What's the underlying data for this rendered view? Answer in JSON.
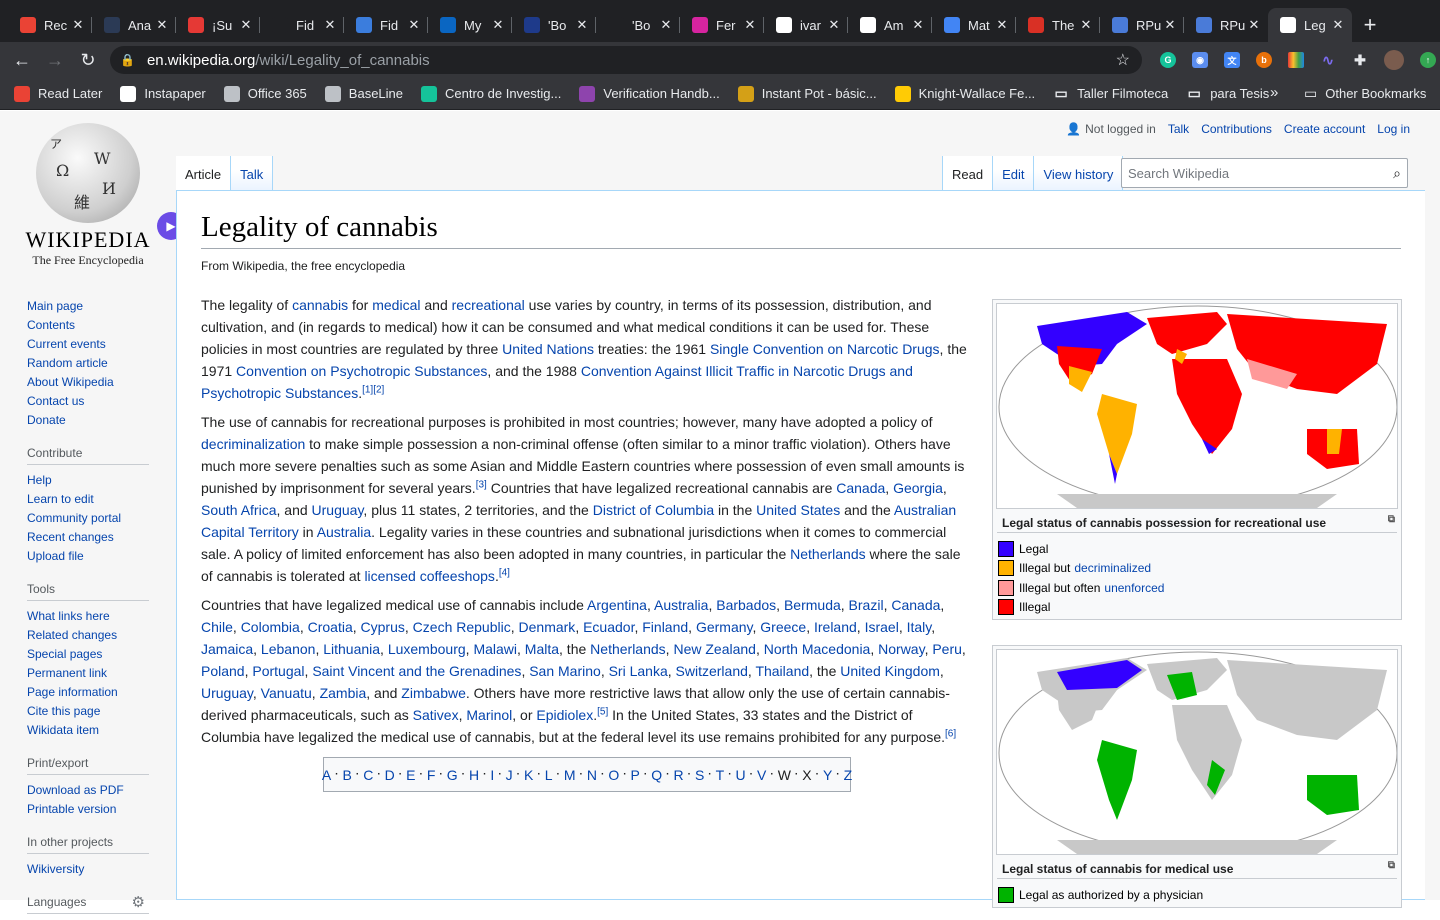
{
  "browser": {
    "tabs": [
      {
        "title": "Rec",
        "icon": "gmail-icon",
        "color": "#ea4335"
      },
      {
        "title": "Ana",
        "icon": "p-icon",
        "color": "#2b3a55"
      },
      {
        "title": "¡Su",
        "icon": "record-icon",
        "color": "#e53935"
      },
      {
        "title": "Fid",
        "icon": "a-icon",
        "color": "#202124"
      },
      {
        "title": "Fid",
        "icon": "blue-doc-icon",
        "color": "#3b7ddd"
      },
      {
        "title": "My",
        "icon": "linkedin-icon",
        "color": "#0a66c2"
      },
      {
        "title": "'Bo",
        "icon": "w-icon",
        "color": "#1e3a8a"
      },
      {
        "title": "'Bo",
        "icon": "guardian-icon",
        "color": "#202124"
      },
      {
        "title": "Fer",
        "icon": "instagram-icon",
        "color": "#d6249f"
      },
      {
        "title": "ivar",
        "icon": "google-icon",
        "color": "#ffffff"
      },
      {
        "title": "Am",
        "icon": "amazon-icon",
        "color": "#ffffff"
      },
      {
        "title": "Mat",
        "icon": "docs-icon",
        "color": "#4285f4"
      },
      {
        "title": "The",
        "icon": "cjr-icon",
        "color": "#d93025"
      },
      {
        "title": "RPu",
        "icon": "r-icon",
        "color": "#4a7bd8"
      },
      {
        "title": "RPu",
        "icon": "r-icon",
        "color": "#4a7bd8"
      },
      {
        "title": "Leg",
        "icon": "wikipedia-icon",
        "color": "#ffffff"
      }
    ],
    "url_domain": "en.wikipedia.org",
    "url_path": "/wiki/Legality_of_cannabis",
    "bookmarks": [
      {
        "label": "Read Later",
        "icon": "gmail-icon",
        "color": "#ea4335"
      },
      {
        "label": "Instapaper",
        "icon": "instapaper-icon",
        "color": "#ffffff"
      },
      {
        "label": "Office 365",
        "icon": "globe-icon",
        "color": "#bdc1c6"
      },
      {
        "label": "BaseLine",
        "icon": "apple-icon",
        "color": "#bdc1c6"
      },
      {
        "label": "Centro de Investig...",
        "icon": "grammarly-icon",
        "color": "#15c39a"
      },
      {
        "label": "Verification Handb...",
        "icon": "feather-icon",
        "color": "#8e44ad"
      },
      {
        "label": "Instant Pot - básic...",
        "icon": "instant-pot-icon",
        "color": "#d4a017"
      },
      {
        "label": "Knight-Wallace Fe...",
        "icon": "michigan-icon",
        "color": "#ffcb05"
      },
      {
        "label": "Taller Filmoteca",
        "icon": "folder-icon",
        "color": "#e8eaed"
      },
      {
        "label": "para Tesis",
        "icon": "folder-icon",
        "color": "#e8eaed"
      }
    ],
    "bookmarks_more": "»",
    "other_bookmarks": "Other Bookmarks"
  },
  "wiki": {
    "wordmark": "WIKIPEDIA",
    "tagline": "The Free Encyclopedia",
    "personal": {
      "not_logged": "Not logged in",
      "links": [
        "Talk",
        "Contributions",
        "Create account",
        "Log in"
      ]
    },
    "left_tabs": [
      "Article",
      "Talk"
    ],
    "right_tabs": [
      "Read",
      "Edit",
      "View history"
    ],
    "search_placeholder": "Search Wikipedia",
    "nav": [
      "Main page",
      "Contents",
      "Current events",
      "Random article",
      "About Wikipedia",
      "Contact us",
      "Donate"
    ],
    "contribute_head": "Contribute",
    "contribute": [
      "Help",
      "Learn to edit",
      "Community portal",
      "Recent changes",
      "Upload file"
    ],
    "tools_head": "Tools",
    "tools": [
      "What links here",
      "Related changes",
      "Special pages",
      "Permanent link",
      "Page information",
      "Cite this page",
      "Wikidata item"
    ],
    "print_head": "Print/export",
    "print": [
      "Download as PDF",
      "Printable version"
    ],
    "projects_head": "In other projects",
    "projects": [
      "Wikiversity"
    ],
    "languages_head": "Languages",
    "title": "Legality of cannabis",
    "site_sub": "From Wikipedia, the free encyclopedia",
    "toc": [
      "A",
      "B",
      "C",
      "D",
      "E",
      "F",
      "G",
      "H",
      "I",
      "J",
      "K",
      "L",
      "M",
      "N",
      "O",
      "P",
      "Q",
      "R",
      "S",
      "T",
      "U",
      "V",
      "W",
      "X",
      "Y",
      "Z"
    ],
    "toc_plain": [
      "W",
      "X"
    ],
    "thumb1": {
      "caption": "Legal status of cannabis possession for recreational use",
      "legend": [
        {
          "text": "Legal",
          "link": "",
          "color": "#3300ff"
        },
        {
          "text": "Illegal but",
          "link": "decriminalized",
          "color": "#ffb200"
        },
        {
          "text": "Illegal but often",
          "link": "unenforced",
          "color": "#ff9999"
        },
        {
          "text": "Illegal",
          "link": "",
          "color": "#ff0000"
        }
      ]
    },
    "thumb2": {
      "caption": "Legal status of cannabis for medical use",
      "legend": [
        {
          "text": "Legal as authorized by a physician",
          "link": "",
          "color": "#00b300"
        }
      ]
    }
  }
}
